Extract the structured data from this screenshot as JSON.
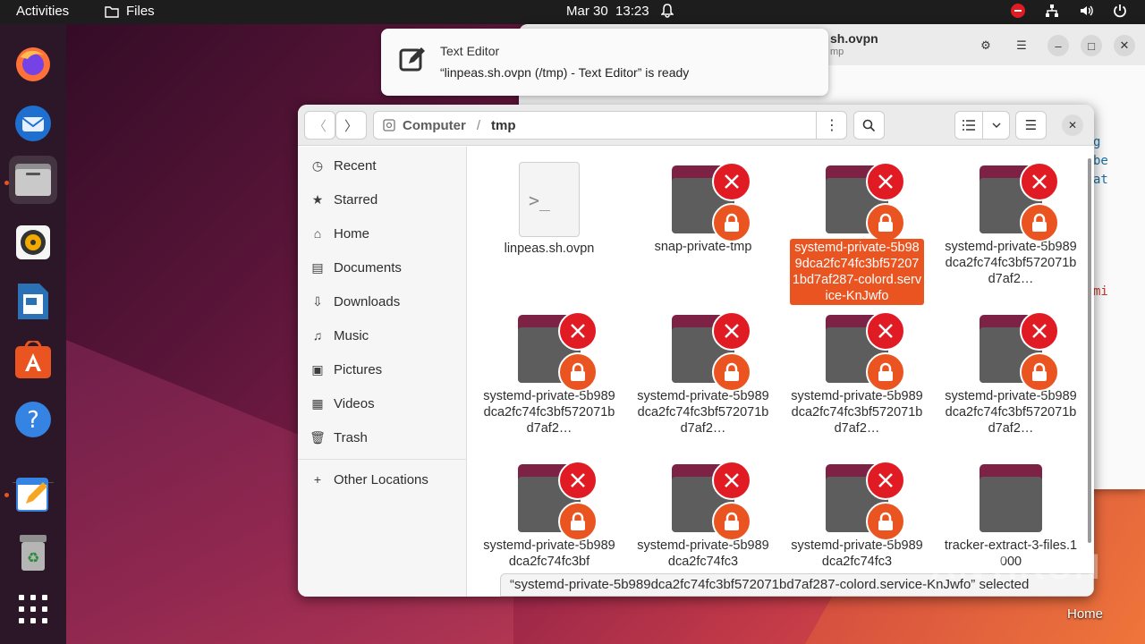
{
  "topbar": {
    "activities": "Activities",
    "app_name": "Files",
    "date": "Mar 30",
    "time": "13:23"
  },
  "dock": {
    "items": [
      "firefox-icon",
      "thunderbird-icon",
      "files-icon",
      "rhythmbox-icon",
      "libreoffice-writer-icon",
      "app-center-icon",
      "help-icon",
      "text-editor-icon",
      "trash-icon",
      "show-apps-icon"
    ]
  },
  "editor": {
    "title": "sh.ovpn",
    "subtitle": "mp",
    "code_fragments": [
      "g",
      "be",
      "at",
      "mi"
    ]
  },
  "notification": {
    "app": "Text Editor",
    "message": "“linpeas.sh.ovpn (/tmp) - Text Editor” is ready"
  },
  "files": {
    "path": {
      "root": "Computer",
      "separator": "/",
      "current": "tmp"
    },
    "sidebar": [
      {
        "label": "Recent",
        "icon": "clock-icon"
      },
      {
        "label": "Starred",
        "icon": "star-icon"
      },
      {
        "label": "Home",
        "icon": "home-icon"
      },
      {
        "label": "Documents",
        "icon": "document-icon"
      },
      {
        "label": "Downloads",
        "icon": "download-icon"
      },
      {
        "label": "Music",
        "icon": "music-icon"
      },
      {
        "label": "Pictures",
        "icon": "picture-icon"
      },
      {
        "label": "Videos",
        "icon": "video-icon"
      },
      {
        "label": "Trash",
        "icon": "trash-icon"
      },
      {
        "label": "Other Locations",
        "icon": "plus-icon"
      }
    ],
    "items": [
      {
        "name": "linpeas.sh.ovpn",
        "type": "file"
      },
      {
        "name": "snap-private-tmp",
        "type": "locked-folder"
      },
      {
        "name": "systemd-private-5b989dca2fc74fc3bf572071bd7af287-colord.service-KnJwfo",
        "type": "locked-folder",
        "selected": true
      },
      {
        "name": "systemd-private-5b989dca2fc74fc3bf572071bd7af2…",
        "type": "locked-folder"
      },
      {
        "name": "systemd-private-5b989dca2fc74fc3bf572071bd7af2…",
        "type": "locked-folder"
      },
      {
        "name": "systemd-private-5b989dca2fc74fc3bf572071bd7af2…",
        "type": "locked-folder"
      },
      {
        "name": "systemd-private-5b989dca2fc74fc3bf572071bd7af2…",
        "type": "locked-folder"
      },
      {
        "name": "systemd-private-5b989dca2fc74fc3bf572071bd7af2…",
        "type": "locked-folder"
      },
      {
        "name": "systemd-private-5b989dca2fc74fc3bf",
        "type": "locked-folder"
      },
      {
        "name": "systemd-private-5b989dca2fc74fc3",
        "type": "locked-folder"
      },
      {
        "name": "systemd-private-5b989dca2fc74fc3",
        "type": "locked-folder"
      },
      {
        "name": "tracker-extract-3-files.1000",
        "type": "folder"
      }
    ],
    "status": "“systemd-private-5b989dca2fc74fc3bf572071bd7af287-colord.service-KnJwfo” selected"
  },
  "desktop": {
    "home_label": "Home",
    "watermark": "ANY.RUN"
  },
  "colors": {
    "accent": "#e95420",
    "error": "#e01b24",
    "folder_back": "#7d2145",
    "folder_front": "#5d5d5d"
  }
}
